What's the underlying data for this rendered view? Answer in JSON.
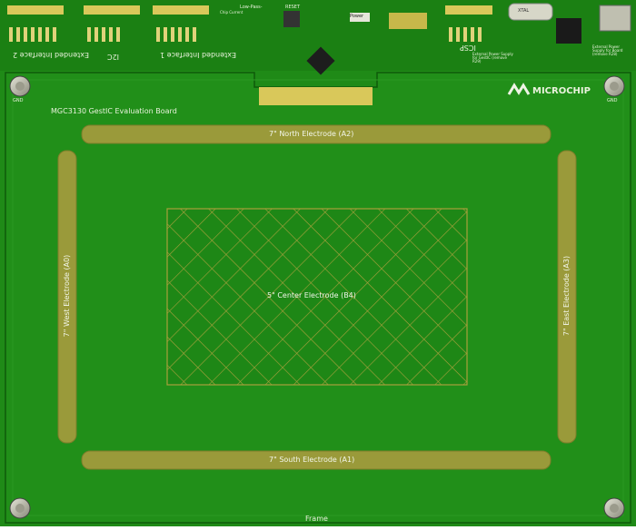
{
  "board_title": "MGC3130 GestIC Evaluation Board",
  "brand": "MICROCHIP",
  "electrodes": {
    "north": "7\" North Electrode (A2)",
    "south": "7\" South Electrode (A1)",
    "west": "7\" West Electrode (A0)",
    "east": "7\" East Electrode (A3)",
    "center": "5\" Center Electrode (B4)"
  },
  "frame_label": "Frame",
  "gnd_labels": [
    "GND",
    "GND"
  ],
  "headers": {
    "extended_interface_2": "Extended Interface 2",
    "i2c": "I2C",
    "extended_interface_1": "Extended Interface 1",
    "icsp": "ICSP"
  },
  "top_labels": {
    "low_pass": "Low-Pass-",
    "reset": "RESET",
    "power": "Power",
    "chip_current": "Chip Current",
    "ext_power_gestic": "External Power Supply for GestIC (remove R29)",
    "ext_power_board": "External Power Supply for Board (remove R28)",
    "crystal": "XTAL"
  },
  "colors": {
    "pcb": "#1f8a17",
    "pcb_dark": "#16700f",
    "silk": "#e6efd8",
    "copper": "#9a9a3a",
    "edge": "#1c1c1c"
  }
}
